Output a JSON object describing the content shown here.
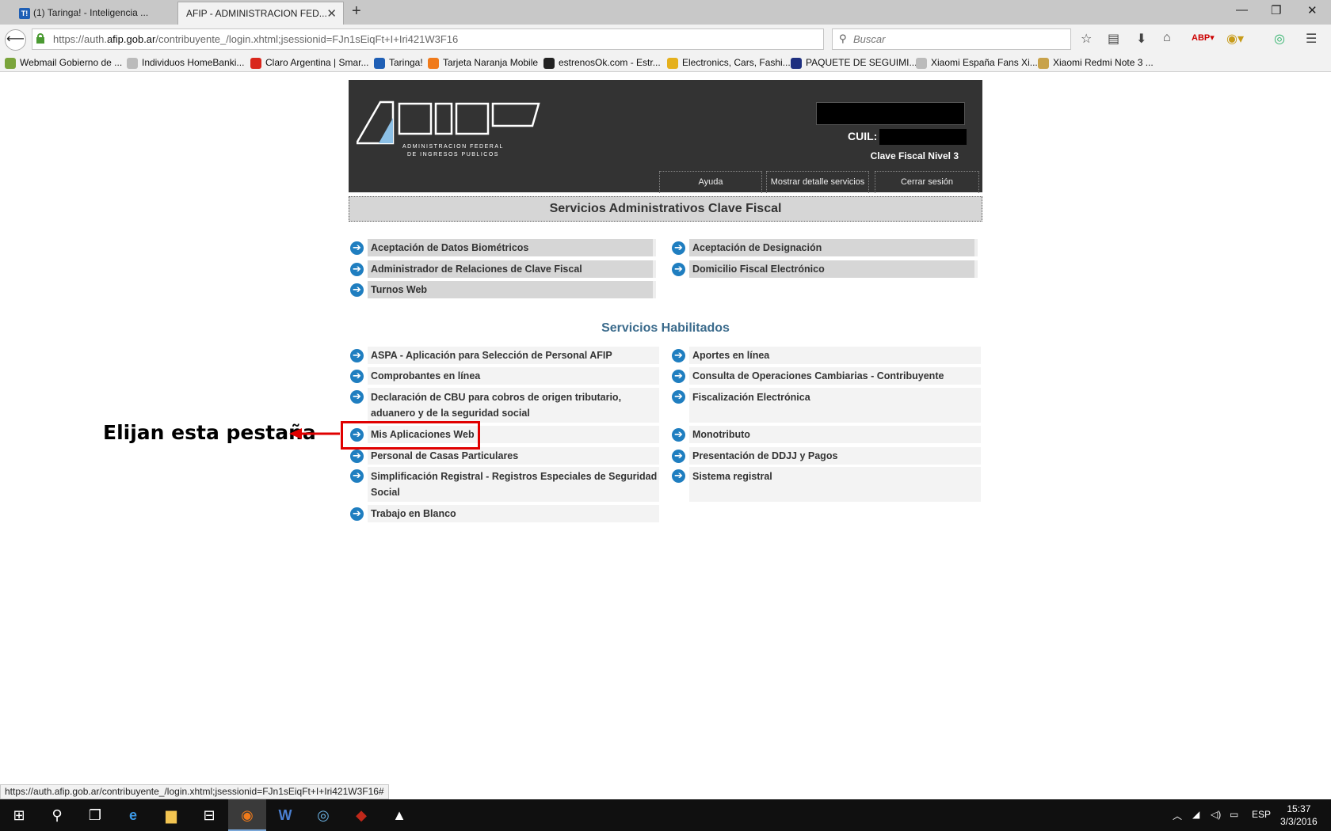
{
  "browser": {
    "tabs": [
      {
        "label": "(1) Taringa! - Inteligencia ...",
        "icon": "taringa-favicon"
      },
      {
        "label": "AFIP - ADMINISTRACION FED...",
        "icon": "afip-favicon"
      }
    ],
    "url": {
      "prefix": "https://auth.",
      "domain": "afip.gob.ar",
      "path": "/contribuyente_/login.xhtml;jsessionid=FJn1sEiqFt+I+Iri421W3F16"
    },
    "search_placeholder": "Buscar",
    "bookmarks": [
      {
        "label": "Webmail Gobierno de ...",
        "color": "#7aa43b"
      },
      {
        "label": "Individuos HomeBanki...",
        "color": "#bbbbbb"
      },
      {
        "label": "Claro Argentina | Smar...",
        "color": "#d9261c"
      },
      {
        "label": "Taringa!",
        "color": "#1f5fb5"
      },
      {
        "label": "Tarjeta Naranja Mobile",
        "color": "#f07a1a"
      },
      {
        "label": "estrenosOk.com - Estr...",
        "color": "#222222"
      },
      {
        "label": "Electronics, Cars, Fashi...",
        "color": "#e5b01c"
      },
      {
        "label": "PAQUETE DE SEGUIMI...",
        "color": "#1e2f80"
      },
      {
        "label": "Xiaomi España Fans Xi...",
        "color": "#bbbbbb"
      },
      {
        "label": "Xiaomi Redmi Note 3 ...",
        "color": "#c8a24a"
      }
    ],
    "status_url": "https://auth.afip.gob.ar/contribuyente_/login.xhtml;jsessionid=FJn1sEiqFt+I+Iri421W3F16#"
  },
  "header": {
    "logo_text": "AFIP",
    "logo_subtitle_1": "ADMINISTRACION FEDERAL",
    "logo_subtitle_2": "DE INGRESOS PUBLICOS",
    "cuil_label": "CUIL:",
    "nivel": "Clave Fiscal Nivel 3",
    "buttons": [
      "Ayuda",
      "Mostrar detalle servicios",
      "Cerrar sesión"
    ]
  },
  "admin": {
    "title": "Servicios Administrativos Clave Fiscal",
    "left": [
      "Aceptación de Datos Biométricos",
      "Administrador de Relaciones de Clave Fiscal",
      "Turnos Web"
    ],
    "right": [
      "Aceptación de Designación",
      "Domicilio Fiscal Electrónico"
    ]
  },
  "habilitados": {
    "title": "Servicios Habilitados",
    "left": [
      "ASPA - Aplicación para Selección de Personal AFIP",
      "Comprobantes en línea",
      "Declaración de CBU para cobros de origen tributario, aduanero y de la seguridad social",
      "Mis Aplicaciones Web",
      "Personal de Casas Particulares",
      "Simplificación Registral - Registros Especiales de Seguridad Social",
      "Trabajo en Blanco"
    ],
    "right": [
      "Aportes en línea",
      "Consulta de Operaciones Cambiarias - Contribuyente",
      "Fiscalización Electrónica",
      "Monotributo",
      "Presentación de DDJJ y Pagos",
      "Sistema registral"
    ]
  },
  "annotation": "Elijan esta pestaña",
  "taskbar": {
    "language": "ESP",
    "time": "15:37",
    "date": "3/3/2016"
  }
}
